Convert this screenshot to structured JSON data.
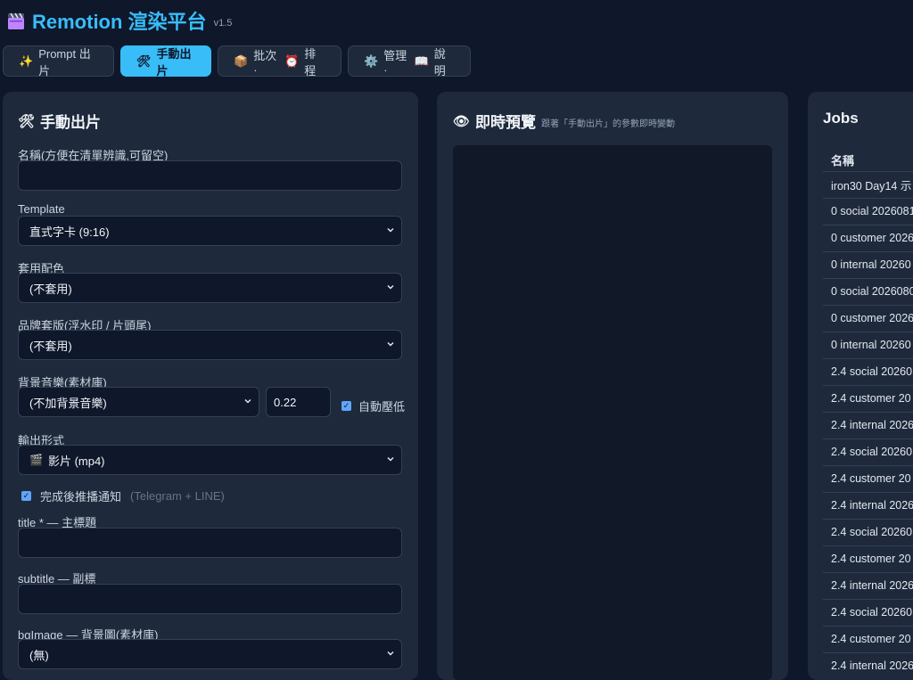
{
  "app": {
    "title": "Remotion 渲染平台",
    "version": "v1.5",
    "logo_icon": "clapperboard-icon"
  },
  "tabs": [
    {
      "label": "Prompt 出片",
      "icon": "sparkles-icon",
      "active": false
    },
    {
      "label": "手動出片",
      "icon": "tools-icon",
      "active": true
    },
    {
      "label": "批次 · ",
      "label2": "排程",
      "icon": "package-icon",
      "icon2": "alarm-clock-icon",
      "active": false
    },
    {
      "label": "管理 · ",
      "label2": "說明",
      "icon": "gear-icon",
      "icon2": "book-icon",
      "active": false
    }
  ],
  "manual": {
    "title": "手動出片",
    "name_label": "名稱(方便在清單辨識,可留空)",
    "name_value": "",
    "template_label": "Template",
    "template_value": "直式字卡 (9:16)",
    "palette_label": "套用配色",
    "palette_value": "(不套用)",
    "brand_label": "品牌套版(浮水印 / 片頭尾)",
    "brand_value": "(不套用)",
    "music_label": "背景音樂(素材庫)",
    "music_value": "(不加背景音樂)",
    "volume_value": "0.22",
    "ducking_label": "自動壓低",
    "output_label": "輸出形式",
    "output_value": "影片 (mp4)",
    "notify_label": "完成後推播通知",
    "notify_hint": "(Telegram + LINE)",
    "title_field_label": "title * — 主標題",
    "subtitle_field_label": "subtitle — 副標",
    "bgimage_label": "bgImage — 背景圖(素材庫)",
    "bgimage_value": "(無)"
  },
  "preview": {
    "title": "即時預覽",
    "hint": "跟著「手動出片」的參數即時變動"
  },
  "jobs": {
    "title": "Jobs",
    "column": "名稱",
    "rows": [
      "iron30 Day14 示",
      "0 social 2026081",
      "0 customer 2026",
      "0 internal 20260",
      "0 social 2026080",
      "0 customer 2026",
      "0 internal 20260",
      "2.4 social 20260",
      "2.4 customer 20",
      "2.4 internal 2026",
      "2.4 social 20260",
      "2.4 customer 20",
      "2.4 internal 2026",
      "2.4 social 20260",
      "2.4 customer 20",
      "2.4 internal 2026",
      "2.4 social 20260",
      "2.4 customer 20",
      "2.4 internal 2026"
    ]
  },
  "colors": {
    "accent": "#38bdf8",
    "bg": "#0f172a",
    "panel": "#1e293b",
    "checkbox": "#60a5fa"
  }
}
